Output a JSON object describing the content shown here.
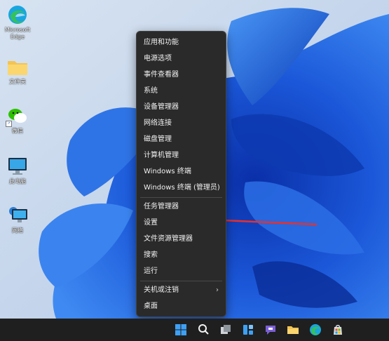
{
  "desktop": {
    "icons": [
      {
        "label": "Microsoft\nEdge",
        "icon": "edge-icon"
      },
      {
        "label": "文件夹",
        "icon": "folder-icon"
      },
      {
        "label": "微信",
        "icon": "wechat-icon"
      },
      {
        "label": "此电脑",
        "icon": "this-pc-icon"
      },
      {
        "label": "网络",
        "icon": "network-icon"
      }
    ]
  },
  "context_menu": {
    "items": [
      "应用和功能",
      "电源选项",
      "事件查看器",
      "系统",
      "设备管理器",
      "网络连接",
      "磁盘管理",
      "计算机管理",
      "Windows 终端",
      "Windows 终端 (管理员)",
      "任务管理器",
      "设置",
      "文件资源管理器",
      "搜索",
      "运行",
      "关机或注销",
      "桌面"
    ],
    "submenu_chevron": "›"
  },
  "taskbar": {
    "icons": [
      "start-icon",
      "search-icon",
      "task-view-icon",
      "widgets-icon",
      "teams-chat-icon",
      "file-explorer-icon",
      "edge-icon",
      "store-icon"
    ]
  },
  "colors": {
    "menu_bg": "#2a2a2a",
    "arrow": "#e8302a",
    "wallpaper_blue": "#1e5ad6"
  }
}
